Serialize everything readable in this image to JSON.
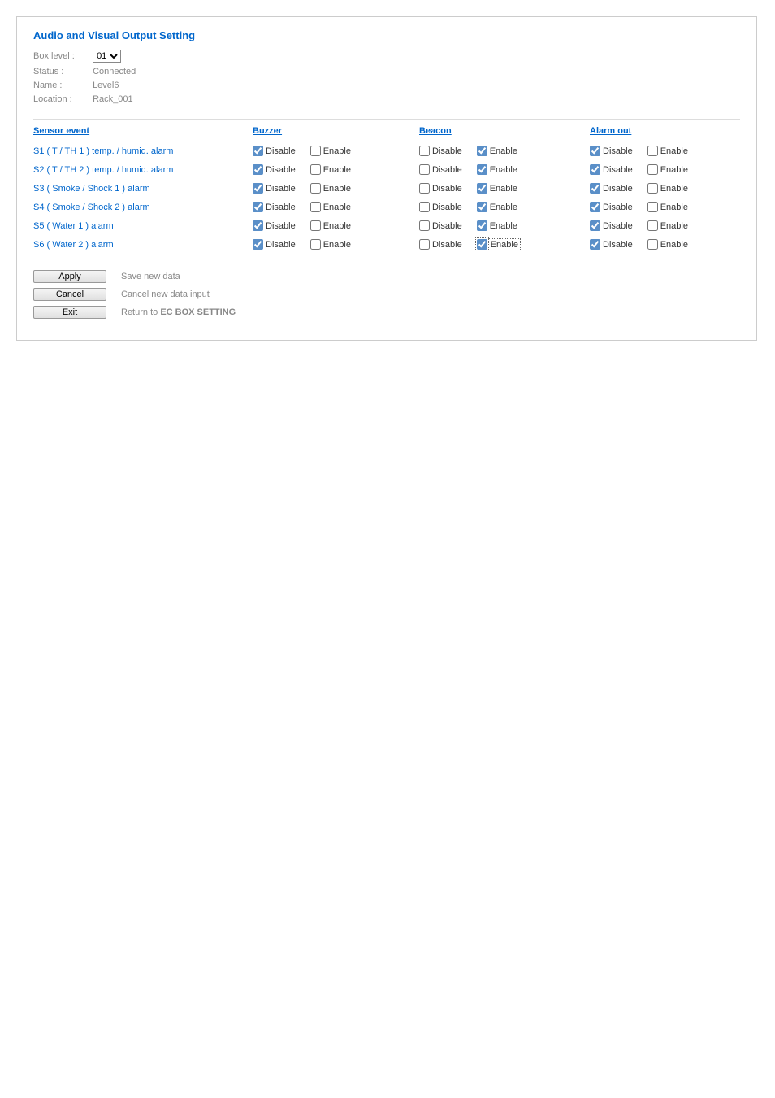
{
  "title": "Audio and Visual Output Setting",
  "info": {
    "box_level_label": "Box level :",
    "box_level_value": "01",
    "status_label": "Status :",
    "status_value": "Connected",
    "name_label": "Name :",
    "name_value": "Level6",
    "location_label": "Location :",
    "location_value": "Rack_001"
  },
  "headers": {
    "sensor": "Sensor event",
    "buzzer": "Buzzer",
    "beacon": "Beacon",
    "alarm_out": "Alarm out"
  },
  "labels": {
    "disable": "Disable",
    "enable": "Enable"
  },
  "rows": [
    {
      "name": "S1 ( T / TH 1 ) temp. / humid. alarm",
      "buzzer": {
        "disable": true,
        "enable": false
      },
      "beacon": {
        "disable": false,
        "enable": true
      },
      "alarm": {
        "disable": true,
        "enable": false
      }
    },
    {
      "name": "S2 ( T / TH 2 ) temp. / humid. alarm",
      "buzzer": {
        "disable": true,
        "enable": false
      },
      "beacon": {
        "disable": false,
        "enable": true
      },
      "alarm": {
        "disable": true,
        "enable": false
      }
    },
    {
      "name": "S3 ( Smoke / Shock 1 ) alarm",
      "buzzer": {
        "disable": true,
        "enable": false
      },
      "beacon": {
        "disable": false,
        "enable": true
      },
      "alarm": {
        "disable": true,
        "enable": false
      }
    },
    {
      "name": "S4 ( Smoke / Shock 2 ) alarm",
      "buzzer": {
        "disable": true,
        "enable": false
      },
      "beacon": {
        "disable": false,
        "enable": true
      },
      "alarm": {
        "disable": true,
        "enable": false
      }
    },
    {
      "name": "S5 ( Water 1 ) alarm",
      "buzzer": {
        "disable": true,
        "enable": false
      },
      "beacon": {
        "disable": false,
        "enable": true
      },
      "alarm": {
        "disable": true,
        "enable": false
      }
    },
    {
      "name": "S6 ( Water 2 ) alarm",
      "buzzer": {
        "disable": true,
        "enable": false
      },
      "beacon": {
        "disable": false,
        "enable": true,
        "focus": true
      },
      "alarm": {
        "disable": true,
        "enable": false
      }
    }
  ],
  "buttons": {
    "apply": {
      "label": "Apply",
      "desc": "Save new data"
    },
    "cancel": {
      "label": "Cancel",
      "desc": "Cancel new data input"
    },
    "exit": {
      "label": "Exit",
      "desc": "Return to EC BOX SETTING"
    }
  }
}
